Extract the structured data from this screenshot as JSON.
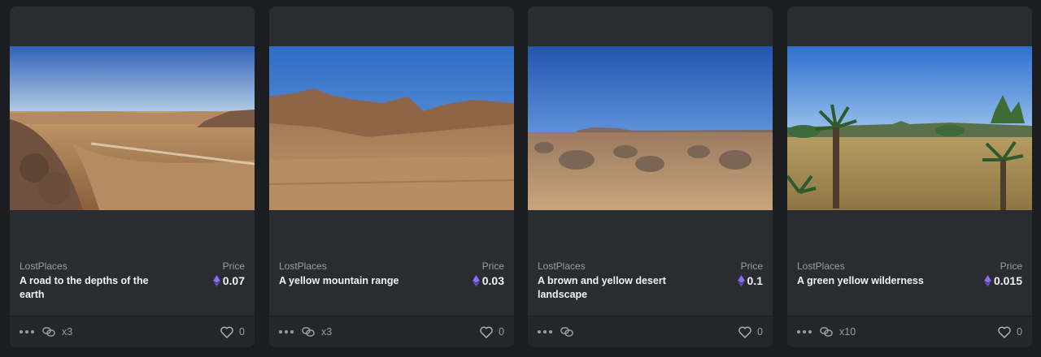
{
  "cards": [
    {
      "collection": "LostPlaces",
      "title": "A road to the depths of the earth",
      "price_label": "Price",
      "price": "0.07",
      "editions": "x3",
      "likes": "0",
      "scene": "desert-road"
    },
    {
      "collection": "LostPlaces",
      "title": "A yellow mountain range",
      "price_label": "Price",
      "price": "0.03",
      "editions": "x3",
      "likes": "0",
      "scene": "mountain-range"
    },
    {
      "collection": "LostPlaces",
      "title": "A brown and yellow desert landscape",
      "price_label": "Price",
      "price": "0.1",
      "editions": "",
      "likes": "0",
      "scene": "desert-shrubland"
    },
    {
      "collection": "LostPlaces",
      "title": "A green yellow wilderness",
      "price_label": "Price",
      "price": "0.015",
      "editions": "x10",
      "likes": "0",
      "scene": "yucca-grassland"
    }
  ],
  "icons": {
    "more": "more-dots-icon",
    "link": "link-chain-icon",
    "like": "heart-icon",
    "currency": "ethereum-icon"
  },
  "colors": {
    "eth_purple": "#8d6bf0",
    "card_bg": "#2a2c31",
    "page_bg": "#1c1d21"
  }
}
